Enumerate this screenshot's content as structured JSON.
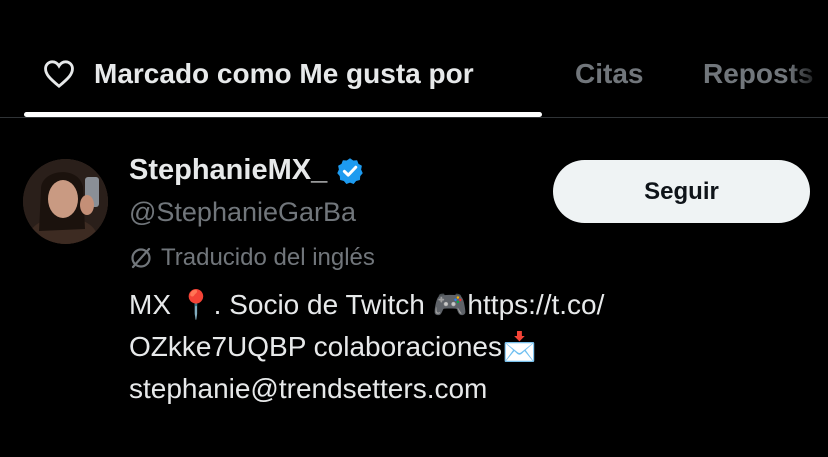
{
  "tabs": {
    "liked_by": "Marcado como Me gusta por",
    "quotes": "Citas",
    "reposts": "Reposts"
  },
  "user": {
    "display_name": "StephanieMX_",
    "handle": "@StephanieGarBa",
    "verified": true,
    "translated_label": "Traducido del inglés",
    "bio_line1": "MX 📍. Socio de Twitch 🎮https://t.co/",
    "bio_line2": "OZkke7UQBP colaboraciones📩",
    "bio_line3": "stephanie@trendsetters.com"
  },
  "follow_button": "Seguir",
  "colors": {
    "background": "#000000",
    "primary_text": "#e7e9ea",
    "secondary_text": "#71767b",
    "verified_badge": "#1d9bf0",
    "button_bg": "#eff3f4"
  },
  "icons": [
    "heart-icon",
    "verified-badge-icon",
    "translate-icon",
    "avatar"
  ]
}
